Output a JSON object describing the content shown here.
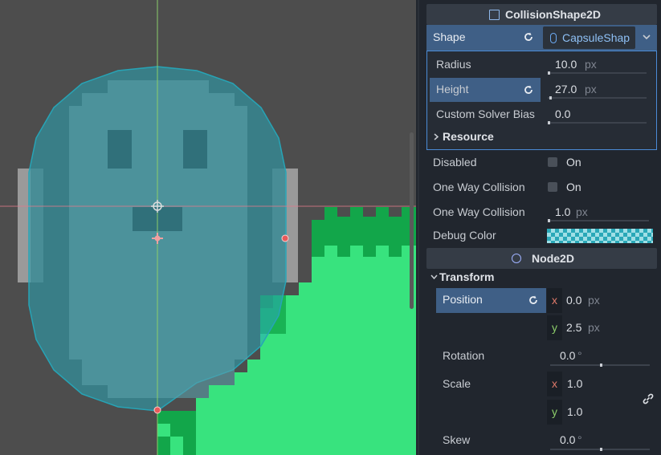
{
  "inspector": {
    "collision_header": "CollisionShape2D",
    "shape_label": "Shape",
    "shape_value": "CapsuleShap",
    "radius_label": "Radius",
    "radius_value": "10.0",
    "height_label": "Height",
    "height_value": "27.0",
    "bias_label": "Custom Solver Bias",
    "bias_value": "0.0",
    "resource_label": "Resource",
    "disabled_label": "Disabled",
    "disabled_value": "On",
    "oneway_label": "One Way Collision",
    "oneway_value": "On",
    "oneway_margin_label": "One Way Collision",
    "oneway_margin_value": "1.0",
    "debug_color_label": "Debug Color",
    "node2d_header": "Node2D",
    "transform_label": "Transform",
    "position_label": "Position",
    "pos_x_axis": "x",
    "pos_x": "0.0",
    "pos_y_axis": "y",
    "pos_y": "2.5",
    "rotation_label": "Rotation",
    "rotation_value": "0.0",
    "scale_label": "Scale",
    "scale_x_axis": "x",
    "scale_x": "1.0",
    "scale_y_axis": "y",
    "scale_y": "1.0",
    "skew_label": "Skew",
    "skew_value": "0.0",
    "unit_px": "px",
    "unit_deg": "°"
  },
  "levels": {
    "radius": 0.01,
    "height": 0.027,
    "bias": 0.0,
    "oneway_margin": 0.0,
    "rotation": 0.5,
    "skew": 0.5
  },
  "colors": {
    "accent": "#4b8bd6",
    "selected_row": "#3f5f86",
    "axis_x": "#e07a6a",
    "axis_y": "#8ccd6a",
    "collision_fill": "#2aa8b8",
    "grass": "#38e37e",
    "grass_dark": "#12a64a"
  },
  "icons": [
    "collision-shape-icon",
    "revert-icon",
    "capsule-icon",
    "dropdown-arrow-icon",
    "chevron-right-icon",
    "chevron-down-icon",
    "node2d-icon",
    "link-icon",
    "checkbox-icon"
  ]
}
